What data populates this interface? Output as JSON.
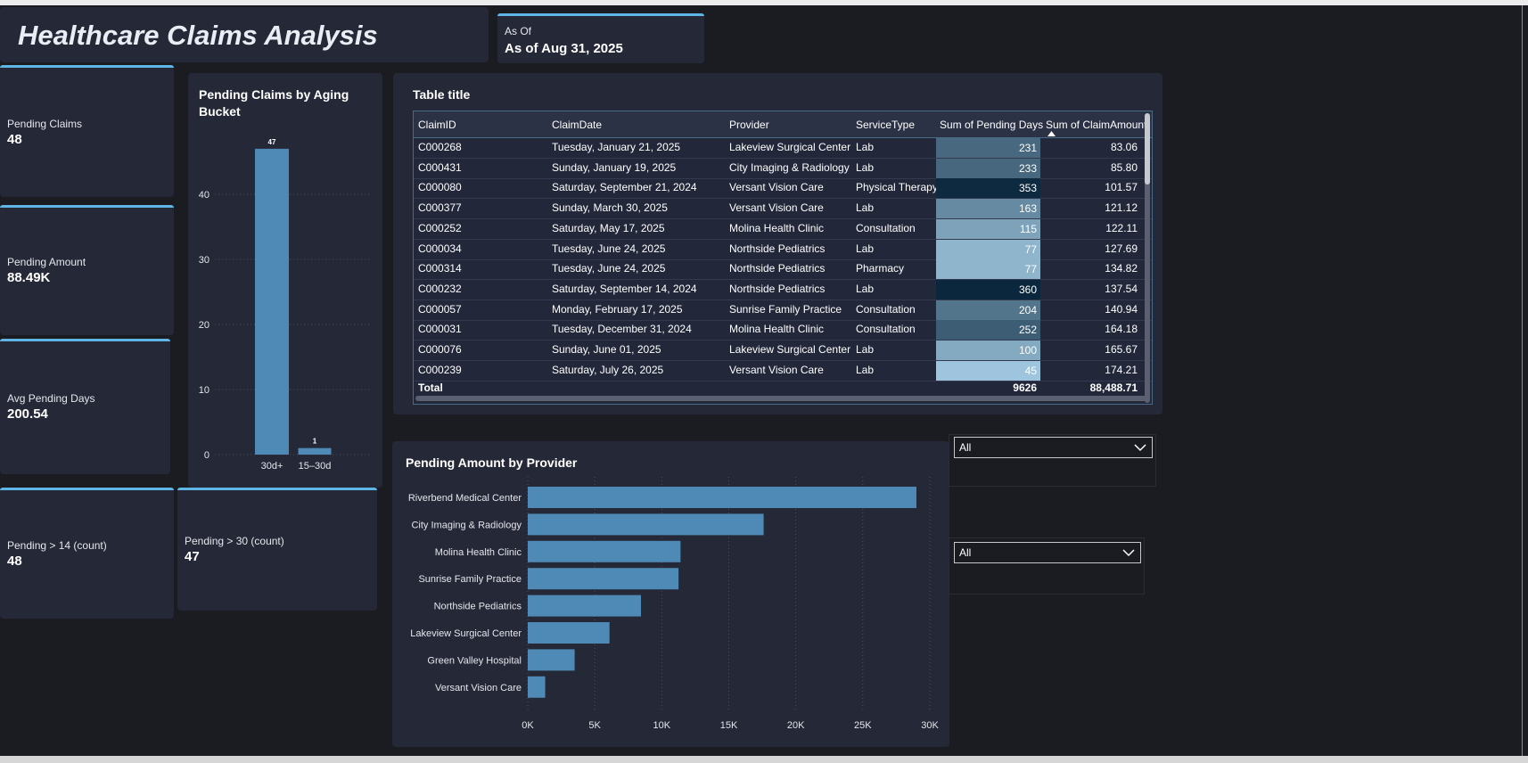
{
  "header": {
    "title": "Healthcare Claims Analysis"
  },
  "as_of": {
    "label": "As Of",
    "value": "As of Aug 31, 2025"
  },
  "kpis": [
    {
      "label": "Pending Claims",
      "value": "48"
    },
    {
      "label": "Pending Amount",
      "value": "88.49K"
    },
    {
      "label": "Avg Pending Days",
      "value": "200.54"
    },
    {
      "label": "Pending > 14 (count)",
      "value": "48"
    },
    {
      "label": "Pending > 30 (count)",
      "value": "47"
    }
  ],
  "aging_chart": {
    "title": "Pending Claims by Aging Bucket",
    "title_lines": [
      "Pending Claims by Aging",
      "Bucket"
    ]
  },
  "provider_chart": {
    "title": "Pending Amount by Provider"
  },
  "table": {
    "title": "Table title",
    "columns": [
      "ClaimID",
      "ClaimDate",
      "Provider",
      "ServiceType",
      "Sum of Pending Days",
      "Sum of ClaimAmount"
    ],
    "rows": [
      {
        "id": "C000268",
        "date": "Tuesday, January 21, 2025",
        "provider": "Lakeview Surgical Center",
        "service": "Lab",
        "days": "231",
        "amount": "83.06"
      },
      {
        "id": "C000431",
        "date": "Sunday, January 19, 2025",
        "provider": "City Imaging & Radiology",
        "service": "Lab",
        "days": "233",
        "amount": "85.80"
      },
      {
        "id": "C000080",
        "date": "Saturday, September 21, 2024",
        "provider": "Versant Vision Care",
        "service": "Physical Therapy",
        "days": "353",
        "amount": "101.57"
      },
      {
        "id": "C000377",
        "date": "Sunday, March 30, 2025",
        "provider": "Versant Vision Care",
        "service": "Lab",
        "days": "163",
        "amount": "121.12"
      },
      {
        "id": "C000252",
        "date": "Saturday, May 17, 2025",
        "provider": "Molina Health Clinic",
        "service": "Consultation",
        "days": "115",
        "amount": "122.11"
      },
      {
        "id": "C000034",
        "date": "Tuesday, June 24, 2025",
        "provider": "Northside Pediatrics",
        "service": "Lab",
        "days": "77",
        "amount": "127.69"
      },
      {
        "id": "C000314",
        "date": "Tuesday, June 24, 2025",
        "provider": "Northside Pediatrics",
        "service": "Pharmacy",
        "days": "77",
        "amount": "134.82"
      },
      {
        "id": "C000232",
        "date": "Saturday, September 14, 2024",
        "provider": "Northside Pediatrics",
        "service": "Lab",
        "days": "360",
        "amount": "137.54"
      },
      {
        "id": "C000057",
        "date": "Monday, February 17, 2025",
        "provider": "Sunrise Family Practice",
        "service": "Consultation",
        "days": "204",
        "amount": "140.94"
      },
      {
        "id": "C000031",
        "date": "Tuesday, December 31, 2024",
        "provider": "Molina Health Clinic",
        "service": "Consultation",
        "days": "252",
        "amount": "164.18"
      },
      {
        "id": "C000076",
        "date": "Sunday, June 01, 2025",
        "provider": "Lakeview Surgical Center",
        "service": "Lab",
        "days": "100",
        "amount": "165.67"
      },
      {
        "id": "C000239",
        "date": "Saturday, July 26, 2025",
        "provider": "Versant Vision Care",
        "service": "Lab",
        "days": "45",
        "amount": "174.21"
      }
    ],
    "total": {
      "label": "Total",
      "days": "9626",
      "amount": "88,488.71"
    }
  },
  "slicers": [
    {
      "value": "All"
    },
    {
      "value": "All"
    }
  ],
  "colors": {
    "accent": "#5fb6e6",
    "bar": "#4e8ab5",
    "panel": "#252837",
    "background": "#1b1c22"
  },
  "icons": {
    "sort": "sort-ascending-icon",
    "dropdown": "chevron-down-icon"
  },
  "chart_data": [
    {
      "type": "bar",
      "title": "Pending Claims by Aging Bucket",
      "categories": [
        "30d+",
        "15–30d"
      ],
      "values": [
        47,
        1
      ],
      "data_labels": [
        "47",
        "1"
      ],
      "ylim": [
        0,
        50
      ],
      "yticks": [
        "0",
        "10",
        "20",
        "30",
        "40"
      ],
      "grid": true
    },
    {
      "type": "bar",
      "orientation": "horizontal",
      "title": "Pending Amount by Provider",
      "categories": [
        "Riverbend Medical Center",
        "City Imaging & Radiology",
        "Molina Health Clinic",
        "Sunrise Family Practice",
        "Northside Pediatrics",
        "Lakeview Surgical Center",
        "Green Valley Hospital",
        "Versant Vision Care"
      ],
      "values": [
        29000,
        17600,
        11400,
        11250,
        8450,
        6100,
        3500,
        1300
      ],
      "xlim": [
        0,
        30000
      ],
      "xticks": [
        "0K",
        "5K",
        "10K",
        "15K",
        "20K",
        "25K",
        "30K"
      ],
      "grid": true
    }
  ]
}
